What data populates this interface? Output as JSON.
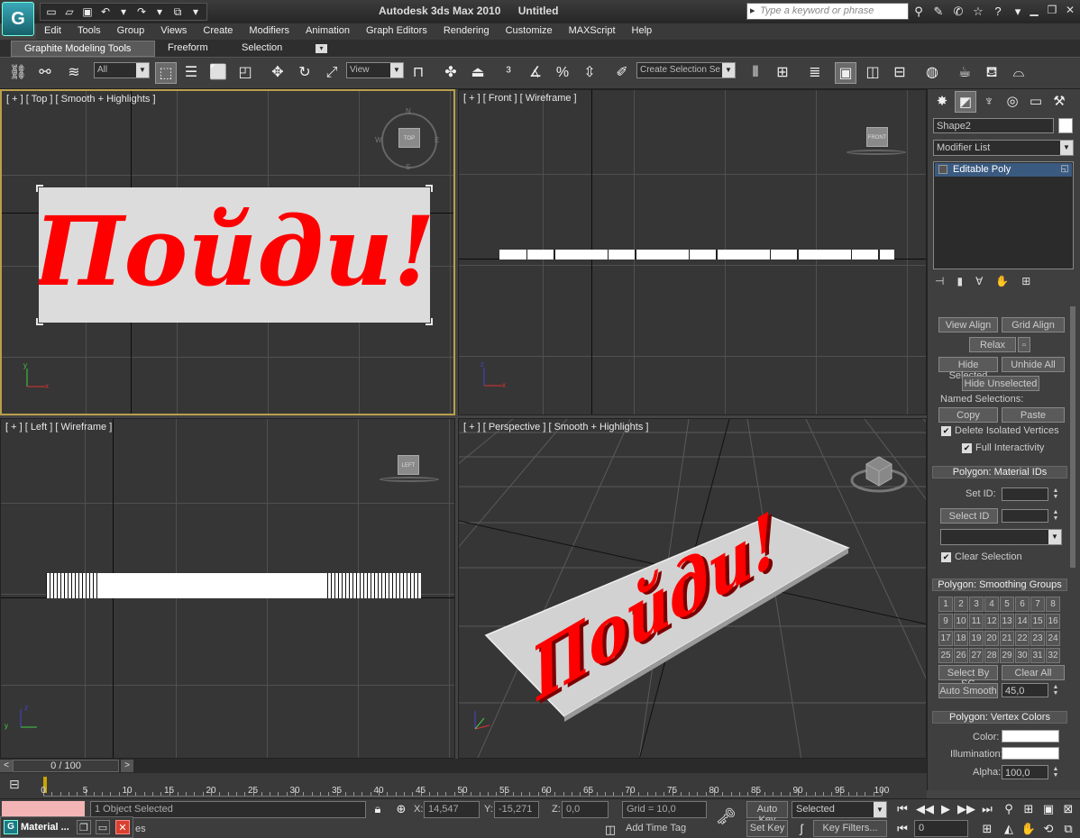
{
  "titlebar": {
    "app": "Autodesk 3ds Max  2010",
    "doc": "Untitled",
    "search_placeholder": "Type a keyword or phrase"
  },
  "menu": [
    "Edit",
    "Tools",
    "Group",
    "Views",
    "Create",
    "Modifiers",
    "Animation",
    "Graph Editors",
    "Rendering",
    "Customize",
    "MAXScript",
    "Help"
  ],
  "ribbon_tabs": [
    "Graphite Modeling Tools",
    "Freeform",
    "Selection"
  ],
  "toolbar": {
    "filter": "All",
    "refcoord": "View",
    "named_selection": "Create Selection Se"
  },
  "viewports": {
    "top": {
      "label": "[ + ] [ Top ] [ Smooth + Highlights ]",
      "cube": "TOP",
      "compass": [
        "N",
        "W",
        "E",
        "S"
      ]
    },
    "front": {
      "label": "[ + ] [ Front ] [ Wireframe ]",
      "cube": "FRONT"
    },
    "left": {
      "label": "[ + ] [ Left ] [ Wireframe ]",
      "cube": "LEFT"
    },
    "persp": {
      "label": "[ + ] [ Perspective ] [ Smooth + Highlights ]"
    },
    "text_3d": "Пойди!",
    "axes": {
      "x": "x",
      "y": "y",
      "z": "z"
    }
  },
  "command_panel": {
    "object_name": "Shape2",
    "modifier_list": "Modifier List",
    "stack_item": "Editable Poly",
    "buttons": {
      "view_align": "View Align",
      "grid_align": "Grid Align",
      "relax": "Relax",
      "hide_selected": "Hide Selected",
      "unhide_all": "Unhide All",
      "hide_unselected": "Hide Unselected",
      "named_selections": "Named Selections:",
      "copy": "Copy",
      "paste": "Paste",
      "delete_isolated": "Delete Isolated Vertices",
      "full_interactivity": "Full Interactivity"
    },
    "material_ids": {
      "title": "Polygon: Material IDs",
      "set_id": "Set ID:",
      "select_id": "Select ID",
      "clear_selection": "Clear Selection"
    },
    "smoothing": {
      "title": "Polygon: Smoothing Groups",
      "groups": [
        "1",
        "2",
        "3",
        "4",
        "5",
        "6",
        "7",
        "8",
        "9",
        "10",
        "11",
        "12",
        "13",
        "14",
        "15",
        "16",
        "17",
        "18",
        "19",
        "20",
        "21",
        "22",
        "23",
        "24",
        "25",
        "26",
        "27",
        "28",
        "29",
        "30",
        "31",
        "32"
      ],
      "select_by_sg": "Select By SG",
      "clear_all": "Clear All",
      "auto_smooth": "Auto Smooth",
      "auto_smooth_value": "45,0"
    },
    "vertex_colors": {
      "title": "Polygon: Vertex Colors",
      "color": "Color:",
      "illumination": "Illumination:",
      "alpha": "Alpha:",
      "alpha_value": "100,0"
    }
  },
  "timeslider": {
    "frame": "0 / 100",
    "ticks": [
      "0",
      "5",
      "10",
      "15",
      "20",
      "25",
      "30",
      "35",
      "40",
      "45",
      "50",
      "55",
      "60",
      "65",
      "70",
      "75",
      "80",
      "85",
      "90",
      "95",
      "100"
    ]
  },
  "status": {
    "selected": "1 Object Selected",
    "x_label": "X:",
    "x": "14,547",
    "y_label": "Y:",
    "y": "-15,271",
    "z_label": "Z:",
    "z": "0,0",
    "grid": "Grid = 10,0",
    "add_time_tag": "Add Time Tag",
    "auto_key": "Auto Key",
    "set_key": "Set Key",
    "selected_dropdown": "Selected",
    "key_filters": "Key Filters...",
    "frame_value": "0",
    "prompt_tail": "es"
  },
  "taskbar": {
    "window": "Material ..."
  },
  "colors": {
    "text_red": "#ff0000",
    "active_border": "#b8a04a",
    "pink_bar": "#f2b4b4"
  }
}
